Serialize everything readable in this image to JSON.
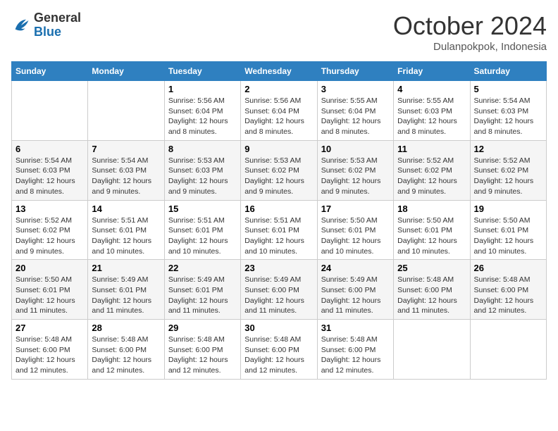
{
  "header": {
    "logo_general": "General",
    "logo_blue": "Blue",
    "month": "October 2024",
    "location": "Dulanpokpok, Indonesia"
  },
  "days_of_week": [
    "Sunday",
    "Monday",
    "Tuesday",
    "Wednesday",
    "Thursday",
    "Friday",
    "Saturday"
  ],
  "weeks": [
    [
      null,
      null,
      {
        "day": 1,
        "sunrise": "5:56 AM",
        "sunset": "6:04 PM",
        "daylight": "12 hours and 8 minutes."
      },
      {
        "day": 2,
        "sunrise": "5:56 AM",
        "sunset": "6:04 PM",
        "daylight": "12 hours and 8 minutes."
      },
      {
        "day": 3,
        "sunrise": "5:55 AM",
        "sunset": "6:04 PM",
        "daylight": "12 hours and 8 minutes."
      },
      {
        "day": 4,
        "sunrise": "5:55 AM",
        "sunset": "6:03 PM",
        "daylight": "12 hours and 8 minutes."
      },
      {
        "day": 5,
        "sunrise": "5:54 AM",
        "sunset": "6:03 PM",
        "daylight": "12 hours and 8 minutes."
      }
    ],
    [
      {
        "day": 6,
        "sunrise": "5:54 AM",
        "sunset": "6:03 PM",
        "daylight": "12 hours and 8 minutes."
      },
      {
        "day": 7,
        "sunrise": "5:54 AM",
        "sunset": "6:03 PM",
        "daylight": "12 hours and 9 minutes."
      },
      {
        "day": 8,
        "sunrise": "5:53 AM",
        "sunset": "6:03 PM",
        "daylight": "12 hours and 9 minutes."
      },
      {
        "day": 9,
        "sunrise": "5:53 AM",
        "sunset": "6:02 PM",
        "daylight": "12 hours and 9 minutes."
      },
      {
        "day": 10,
        "sunrise": "5:53 AM",
        "sunset": "6:02 PM",
        "daylight": "12 hours and 9 minutes."
      },
      {
        "day": 11,
        "sunrise": "5:52 AM",
        "sunset": "6:02 PM",
        "daylight": "12 hours and 9 minutes."
      },
      {
        "day": 12,
        "sunrise": "5:52 AM",
        "sunset": "6:02 PM",
        "daylight": "12 hours and 9 minutes."
      }
    ],
    [
      {
        "day": 13,
        "sunrise": "5:52 AM",
        "sunset": "6:02 PM",
        "daylight": "12 hours and 9 minutes."
      },
      {
        "day": 14,
        "sunrise": "5:51 AM",
        "sunset": "6:01 PM",
        "daylight": "12 hours and 10 minutes."
      },
      {
        "day": 15,
        "sunrise": "5:51 AM",
        "sunset": "6:01 PM",
        "daylight": "12 hours and 10 minutes."
      },
      {
        "day": 16,
        "sunrise": "5:51 AM",
        "sunset": "6:01 PM",
        "daylight": "12 hours and 10 minutes."
      },
      {
        "day": 17,
        "sunrise": "5:50 AM",
        "sunset": "6:01 PM",
        "daylight": "12 hours and 10 minutes."
      },
      {
        "day": 18,
        "sunrise": "5:50 AM",
        "sunset": "6:01 PM",
        "daylight": "12 hours and 10 minutes."
      },
      {
        "day": 19,
        "sunrise": "5:50 AM",
        "sunset": "6:01 PM",
        "daylight": "12 hours and 10 minutes."
      }
    ],
    [
      {
        "day": 20,
        "sunrise": "5:50 AM",
        "sunset": "6:01 PM",
        "daylight": "12 hours and 11 minutes."
      },
      {
        "day": 21,
        "sunrise": "5:49 AM",
        "sunset": "6:01 PM",
        "daylight": "12 hours and 11 minutes."
      },
      {
        "day": 22,
        "sunrise": "5:49 AM",
        "sunset": "6:01 PM",
        "daylight": "12 hours and 11 minutes."
      },
      {
        "day": 23,
        "sunrise": "5:49 AM",
        "sunset": "6:00 PM",
        "daylight": "12 hours and 11 minutes."
      },
      {
        "day": 24,
        "sunrise": "5:49 AM",
        "sunset": "6:00 PM",
        "daylight": "12 hours and 11 minutes."
      },
      {
        "day": 25,
        "sunrise": "5:48 AM",
        "sunset": "6:00 PM",
        "daylight": "12 hours and 11 minutes."
      },
      {
        "day": 26,
        "sunrise": "5:48 AM",
        "sunset": "6:00 PM",
        "daylight": "12 hours and 12 minutes."
      }
    ],
    [
      {
        "day": 27,
        "sunrise": "5:48 AM",
        "sunset": "6:00 PM",
        "daylight": "12 hours and 12 minutes."
      },
      {
        "day": 28,
        "sunrise": "5:48 AM",
        "sunset": "6:00 PM",
        "daylight": "12 hours and 12 minutes."
      },
      {
        "day": 29,
        "sunrise": "5:48 AM",
        "sunset": "6:00 PM",
        "daylight": "12 hours and 12 minutes."
      },
      {
        "day": 30,
        "sunrise": "5:48 AM",
        "sunset": "6:00 PM",
        "daylight": "12 hours and 12 minutes."
      },
      {
        "day": 31,
        "sunrise": "5:48 AM",
        "sunset": "6:00 PM",
        "daylight": "12 hours and 12 minutes."
      },
      null,
      null
    ]
  ]
}
